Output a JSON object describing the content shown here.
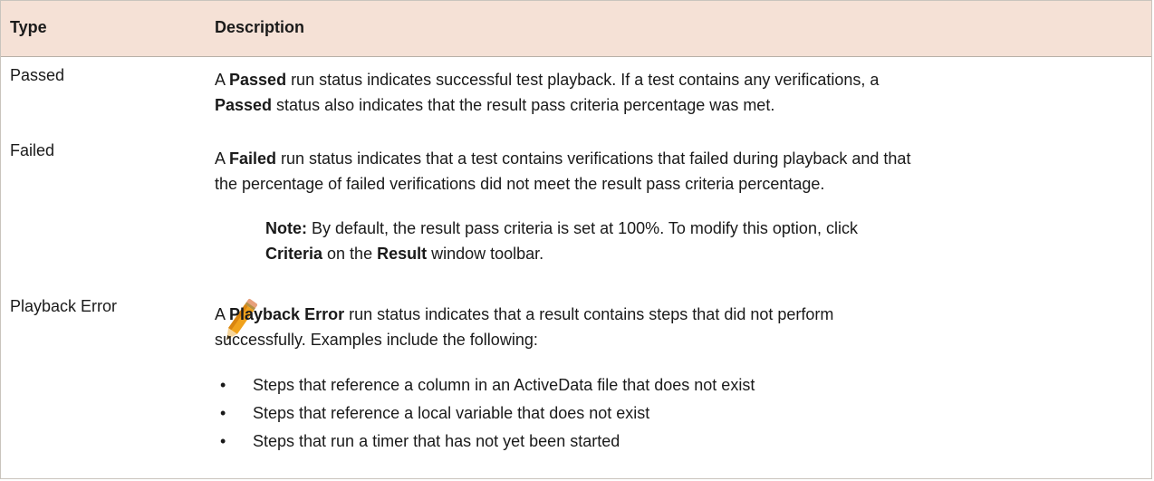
{
  "header": {
    "type_label": "Type",
    "description_label": "Description"
  },
  "rows": [
    {
      "type": "Passed",
      "p1_a": "A ",
      "p1_b": "Passed",
      "p1_c": " run status indicates successful test playback. If a test contains any verifications, a",
      "p2_a": "Passed",
      "p2_b": " status also indicates that the result pass criteria percentage was met."
    },
    {
      "type": "Failed",
      "p1_a": "A ",
      "p1_b": "Failed",
      "p1_c": " run status indicates that a test contains verifications that failed during playback and that",
      "p2": "the percentage of failed verifications did not meet the result pass criteria percentage."
    },
    {
      "type": "Playback Error",
      "p1_a": "A ",
      "p1_b": "Playback Error",
      "p1_c": " run status indicates that a result contains steps that did not perform",
      "p2": "successfully. Examples include the following:"
    }
  ],
  "note": {
    "icon": "pencil-icon",
    "label": "Note:",
    "line1": " By default, the result pass criteria is set at 100%. To modify this option, click",
    "line2_a": "Criteria",
    "line2_b": " on the ",
    "line2_c": "Result",
    "line2_d": " window toolbar."
  },
  "bullets": [
    {
      "mark": "•",
      "text": "Steps that reference a column in an ActiveData file that does not exist"
    },
    {
      "mark": "•",
      "text": "Steps that reference a local variable that does not exist"
    },
    {
      "mark": "•",
      "text": "Steps that run a timer that has not yet been started"
    }
  ],
  "colors": {
    "header_bg": "#f5e1d6",
    "border": "#c9c4bd",
    "pencil_orange": "#f0a21c"
  }
}
